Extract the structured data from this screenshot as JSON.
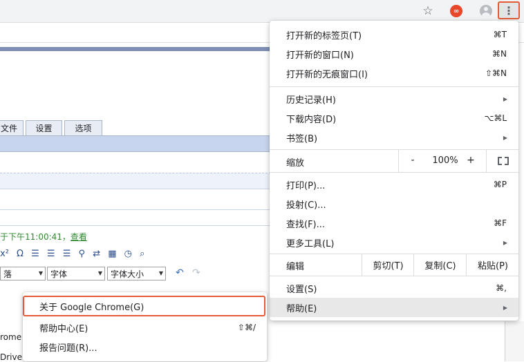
{
  "toolbar": {
    "icons": [
      "star-icon",
      "extension-icon",
      "avatar",
      "more-vert-icon"
    ],
    "extension_text": "∞",
    "kebab_glyph": "⋮",
    "accent_highlight": "#e35a35"
  },
  "page": {
    "tabs": [
      "文件",
      "设置",
      "选项"
    ],
    "saved_text": "于下午11:00:41，",
    "saved_link": "查看",
    "para_select": "落",
    "font_select": "字体",
    "size_select": "字体大小",
    "behind_text1": "rome",
    "behind_text2": "Drive"
  },
  "menu": {
    "new_tab": {
      "label": "打开新的标签页(T)",
      "shortcut": "⌘T"
    },
    "new_window": {
      "label": "打开新的窗口(N)",
      "shortcut": "⌘N"
    },
    "incognito": {
      "label": "打开新的无痕窗口(I)",
      "shortcut": "⇧⌘N"
    },
    "history": {
      "label": "历史记录(H)"
    },
    "downloads": {
      "label": "下载内容(D)",
      "shortcut": "⌥⌘L"
    },
    "bookmarks": {
      "label": "书签(B)"
    },
    "zoom": {
      "label": "缩放",
      "minus": "-",
      "value": "100%",
      "plus": "+"
    },
    "print": {
      "label": "打印(P)...",
      "shortcut": "⌘P"
    },
    "cast": {
      "label": "投射(C)..."
    },
    "find": {
      "label": "查找(F)...",
      "shortcut": "⌘F"
    },
    "more_tools": {
      "label": "更多工具(L)"
    },
    "edit": {
      "label": "编辑",
      "cut": "剪切(T)",
      "copy": "复制(C)",
      "paste": "粘贴(P)"
    },
    "settings": {
      "label": "设置(S)",
      "shortcut": "⌘,"
    },
    "help": {
      "label": "帮助(E)"
    },
    "submenu_arrow": "▶"
  },
  "help_menu": {
    "about": "关于 Google Chrome(G)",
    "help_center": {
      "label": "帮助中心(E)",
      "shortcut": "⇧⌘/"
    },
    "report": "报告问题(R)..."
  }
}
